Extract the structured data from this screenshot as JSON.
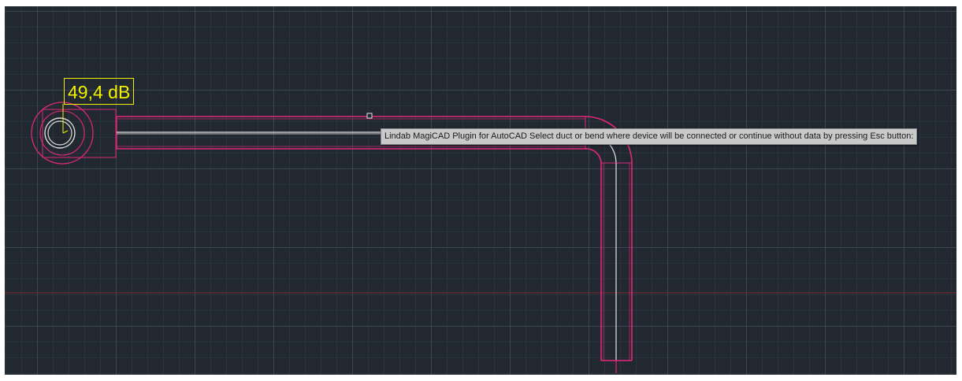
{
  "drawing": {
    "sound_level_label": "49,4 dB"
  },
  "command_tooltip": {
    "text": "Lindab MagiCAD Plugin for AutoCAD Select duct or bend where device will be connected or continue without data by pressing Esc button:"
  },
  "colors": {
    "background": "#212830",
    "grid_major": "#4a5462",
    "grid_minor": "#343c48",
    "duct_outline": "#e0287a",
    "centerline": "#e6e6e6",
    "label_color": "#f2f200",
    "axis_line": "#7a2a32",
    "tooltip_bg": "#c9c9c9"
  }
}
